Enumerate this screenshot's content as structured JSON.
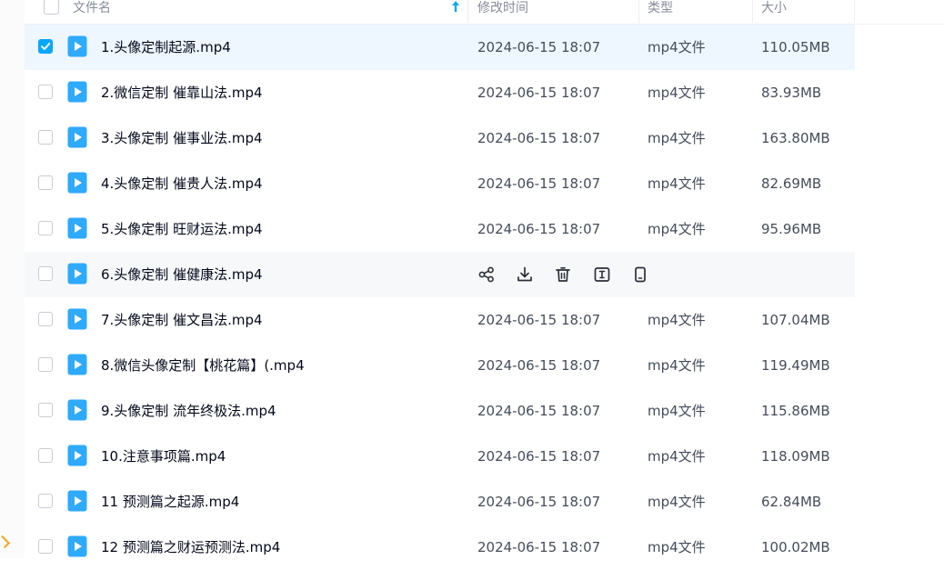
{
  "header": {
    "name_label": "文件名",
    "modified_label": "修改时间",
    "type_label": "类型",
    "size_label": "大小"
  },
  "files": [
    {
      "name": "1.头像定制起源.mp4",
      "modified": "2024-06-15 18:07",
      "type": "mp4文件",
      "size": "110.05MB",
      "checked": true
    },
    {
      "name": "2.微信定制 催靠山法.mp4",
      "modified": "2024-06-15 18:07",
      "type": "mp4文件",
      "size": "83.93MB"
    },
    {
      "name": "3.头像定制 催事业法.mp4",
      "modified": "2024-06-15 18:07",
      "type": "mp4文件",
      "size": "163.80MB"
    },
    {
      "name": "4.头像定制 催贵人法.mp4",
      "modified": "2024-06-15 18:07",
      "type": "mp4文件",
      "size": "82.69MB"
    },
    {
      "name": "5.头像定制 旺财运法.mp4",
      "modified": "2024-06-15 18:07",
      "type": "mp4文件",
      "size": "95.96MB"
    },
    {
      "name": "6.头像定制 催健康法.mp4",
      "hovered": true
    },
    {
      "name": "7.头像定制 催文昌法.mp4",
      "modified": "2024-06-15 18:07",
      "type": "mp4文件",
      "size": "107.04MB"
    },
    {
      "name": "8.微信头像定制【桃花篇】(.mp4",
      "modified": "2024-06-15 18:07",
      "type": "mp4文件",
      "size": "119.49MB"
    },
    {
      "name": "9.头像定制 流年终极法.mp4",
      "modified": "2024-06-15 18:07",
      "type": "mp4文件",
      "size": "115.86MB"
    },
    {
      "name": "10.注意事项篇.mp4",
      "modified": "2024-06-15 18:07",
      "type": "mp4文件",
      "size": "118.09MB"
    },
    {
      "name": "11 预测篇之起源.mp4",
      "modified": "2024-06-15 18:07",
      "type": "mp4文件",
      "size": "62.84MB"
    },
    {
      "name": "12 预测篇之财运预测法.mp4",
      "modified": "2024-06-15 18:07",
      "type": "mp4文件",
      "size": "100.02MB"
    }
  ],
  "hover_actions": [
    "share-icon",
    "download-icon",
    "delete-icon",
    "rename-icon",
    "phone-icon"
  ],
  "colors": {
    "accent": "#06a7ff",
    "selected_row": "#eef6ff",
    "hover_row": "#f7f8fa",
    "file_icon": "#2eaaff"
  }
}
